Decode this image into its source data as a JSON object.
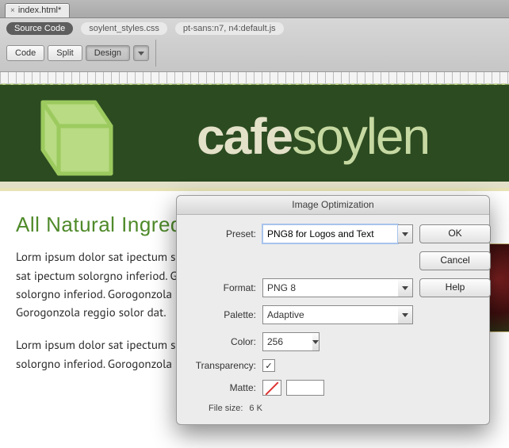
{
  "tabbar": {
    "tab_label": "index.html*"
  },
  "toolbar": {
    "pills": {
      "source": "Source Code",
      "css": "soylent_styles.css",
      "js": "pt-sans:n7, n4:default.js"
    },
    "buttons": {
      "code": "Code",
      "split": "Split",
      "design": "Design"
    }
  },
  "page": {
    "logotype_left": "cafe",
    "logotype_right": "soylen",
    "heading": "All Natural Ingredient",
    "p1": "Lorm ipsum dolor sat ipectum solorgno inferiod. Gorogonzola reaggio solor dat. Ipsum dolor sat ipectum solorgno inferiod. Gorogonzola reggio solor dat.Lorm ipsum dolor sat ipectum solorgno inferiod. Gorogonzola reggio solor dat. Ipsum dolor sat ipectum solorgno inferiod. Gorogonzola reggio solor dat.",
    "p2": "Lorm ipsum dolor sat ipectum solorgno inferiod. Gorogonzola reaggio solor dat. Ipsum dolor solorgno inferiod. Gorogonzola reggio solor dat.Lorm ipsum dolor sat ipectum solorgno in"
  },
  "dialog": {
    "title": "Image Optimization",
    "labels": {
      "preset": "Preset:",
      "format": "Format:",
      "palette": "Palette:",
      "color": "Color:",
      "transparency": "Transparency:",
      "matte": "Matte:",
      "filesize": "File size:"
    },
    "preset_value": "PNG8 for Logos and Text",
    "format_value": "PNG 8",
    "palette_value": "Adaptive",
    "color_value": "256",
    "transparency_checked": "✓",
    "filesize_value": "6 K",
    "buttons": {
      "ok": "OK",
      "cancel": "Cancel",
      "help": "Help"
    }
  }
}
